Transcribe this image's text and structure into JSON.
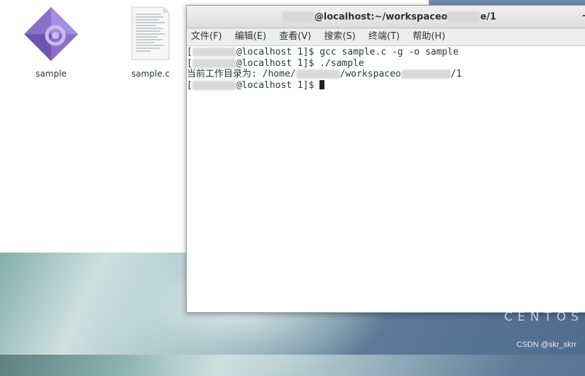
{
  "desktop": {
    "files": [
      {
        "label": "sample",
        "icon": "executable-diamond-icon"
      },
      {
        "label": "sample.c",
        "icon": "text-document-icon"
      }
    ],
    "brand": "CENTOS",
    "watermark": "CSDN @skr_skrr"
  },
  "terminal": {
    "title_prefix": "@localhost:~/workspaceo",
    "title_suffix": "e/1",
    "menu": [
      "文件(F)",
      "编辑(E)",
      "查看(V)",
      "搜索(S)",
      "终端(T)",
      "帮助(H)"
    ],
    "lines": [
      {
        "pre": "[",
        "post": "@localhost 1]$ gcc sample.c -g -o sample"
      },
      {
        "pre": "[",
        "post": "@localhost 1]$ ./sample"
      },
      {
        "pre": "当前工作目录为: /home/",
        "mid": "/workspaceo",
        "post": "/1"
      },
      {
        "pre": "[",
        "post": "@localhost 1]$ "
      }
    ]
  },
  "colors": {
    "terminal_bg": "#ffffff",
    "text": "#2e3436",
    "icon_purple": "#8b6fc9"
  }
}
